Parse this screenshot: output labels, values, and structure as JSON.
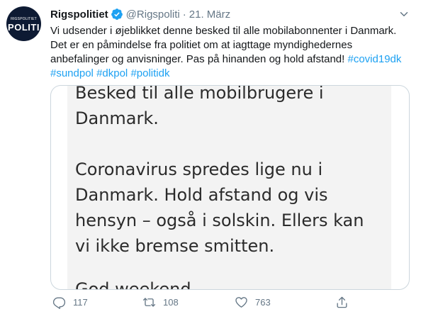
{
  "tweet": {
    "avatar": {
      "small_text": "RIGSPOLITIET",
      "big_text": "POLITI"
    },
    "author": {
      "display_name": "Rigspolitiet",
      "handle": "@Rigspoliti",
      "separator": "·",
      "date": "21. März",
      "verified": true
    },
    "text": {
      "line1": "Vi udsender i øjeblikket denne besked til alle mobilabonnenter i Danmark.",
      "line2": "Det er en påmindelse fra politiet om at iagttage myndighedernes",
      "line3_text": "anbefalinger og anvisninger. Pas på hinanden og hold afstand! ",
      "line3_tag": "#covid19dk",
      "tag_sundpol": "#sundpol",
      "tag_dkpol": "#dkpol",
      "tag_politidk": "#politidk"
    },
    "media": {
      "lines": [
        "Besked til alle mobilbrugere i",
        "Danmark.",
        "Coronavirus spredes lige nu i",
        "Danmark. Hold afstand og vis",
        "hensyn – også i solskin. Ellers kan",
        "vi ikke bremse smitten.",
        "God weekend"
      ]
    },
    "actions": {
      "reply_count": "117",
      "retweet_count": "108",
      "like_count": "763"
    },
    "colors": {
      "accent": "#1da1f2",
      "secondary_text": "#657786",
      "verified": "#1da1f2",
      "avatar_bg": "#0d1a33"
    },
    "icons": {
      "reply": "reply-icon",
      "retweet": "retweet-icon",
      "like": "heart-icon",
      "share": "share-icon",
      "more": "chevron-down-icon",
      "verified": "verified-badge-icon"
    }
  }
}
